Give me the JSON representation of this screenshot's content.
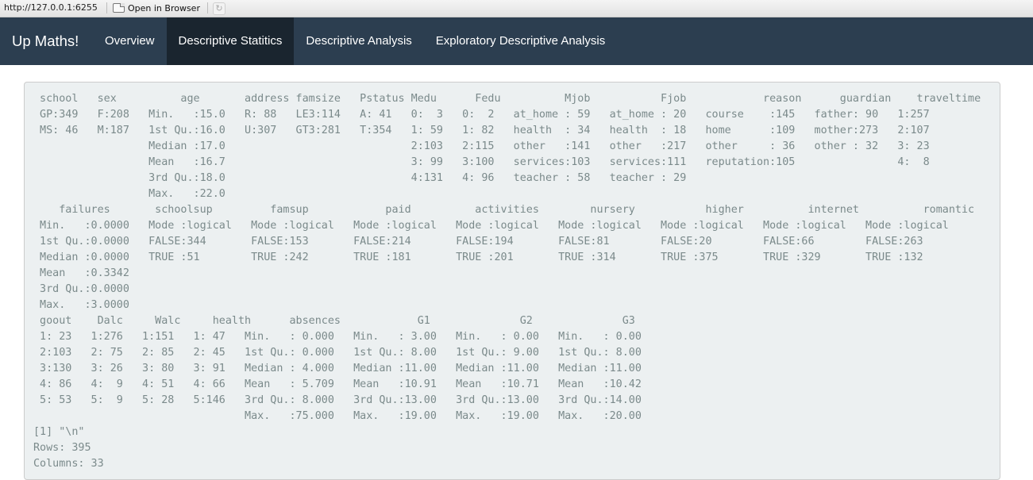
{
  "browser": {
    "url": "http://127.0.0.1:6255",
    "open_in_browser": "Open in Browser",
    "refresh_glyph": "↻"
  },
  "navbar": {
    "brand": "Up Maths!",
    "tabs": [
      {
        "label": "Overview",
        "active": false
      },
      {
        "label": "Descriptive Statitics",
        "active": true
      },
      {
        "label": "Descriptive Analysis",
        "active": false
      },
      {
        "label": "Exploratory Descriptive Analysis",
        "active": false
      }
    ]
  },
  "summary_output": {
    "lines": [
      " school   sex          age       address famsize   Pstatus Medu      Fedu          Mjob           Fjob            reason      guardian    traveltime",
      " GP:349   F:208   Min.   :15.0   R: 88   LE3:114   A: 41   0:  3   0:  2   at_home : 59   at_home : 20   course    :145   father: 90   1:257",
      " MS: 46   M:187   1st Qu.:16.0   U:307   GT3:281   T:354   1: 59   1: 82   health  : 34   health  : 18   home      :109   mother:273   2:107",
      "                  Median :17.0                             2:103   2:115   other   :141   other   :217   other     : 36   other : 32   3: 23",
      "                  Mean   :16.7                             3: 99   3:100   services:103   services:111   reputation:105                4:  8",
      "                  3rd Qu.:18.0                             4:131   4: 96   teacher : 58   teacher : 29",
      "                  Max.   :22.0",
      "    failures       schoolsup         famsup            paid          activities        nursery           higher          internet          romantic",
      " Min.   :0.0000   Mode :logical   Mode :logical   Mode :logical   Mode :logical   Mode :logical   Mode :logical   Mode :logical   Mode :logical",
      " 1st Qu.:0.0000   FALSE:344       FALSE:153       FALSE:214       FALSE:194       FALSE:81        FALSE:20        FALSE:66        FALSE:263",
      " Median :0.0000   TRUE :51        TRUE :242       TRUE :181       TRUE :201       TRUE :314       TRUE :375       TRUE :329       TRUE :132",
      " Mean   :0.3342",
      " 3rd Qu.:0.0000",
      " Max.   :3.0000",
      " goout    Dalc     Walc     health      absences            G1              G2              G3",
      " 1: 23   1:276   1:151   1: 47   Min.   : 0.000   Min.   : 3.00   Min.   : 0.00   Min.   : 0.00",
      " 2:103   2: 75   2: 85   2: 45   1st Qu.: 0.000   1st Qu.: 8.00   1st Qu.: 9.00   1st Qu.: 8.00",
      " 3:130   3: 26   3: 80   3: 91   Median : 4.000   Median :11.00   Median :11.00   Median :11.00",
      " 4: 86   4:  9   4: 51   4: 66   Mean   : 5.709   Mean   :10.91   Mean   :10.71   Mean   :10.42",
      " 5: 53   5:  9   5: 28   5:146   3rd Qu.: 8.000   3rd Qu.:13.00   3rd Qu.:13.00   3rd Qu.:14.00",
      "                                 Max.   :75.000   Max.   :19.00   Max.   :19.00   Max.   :20.00",
      "[1] \"\\n\"",
      "Rows: 395",
      "Columns: 33"
    ]
  }
}
